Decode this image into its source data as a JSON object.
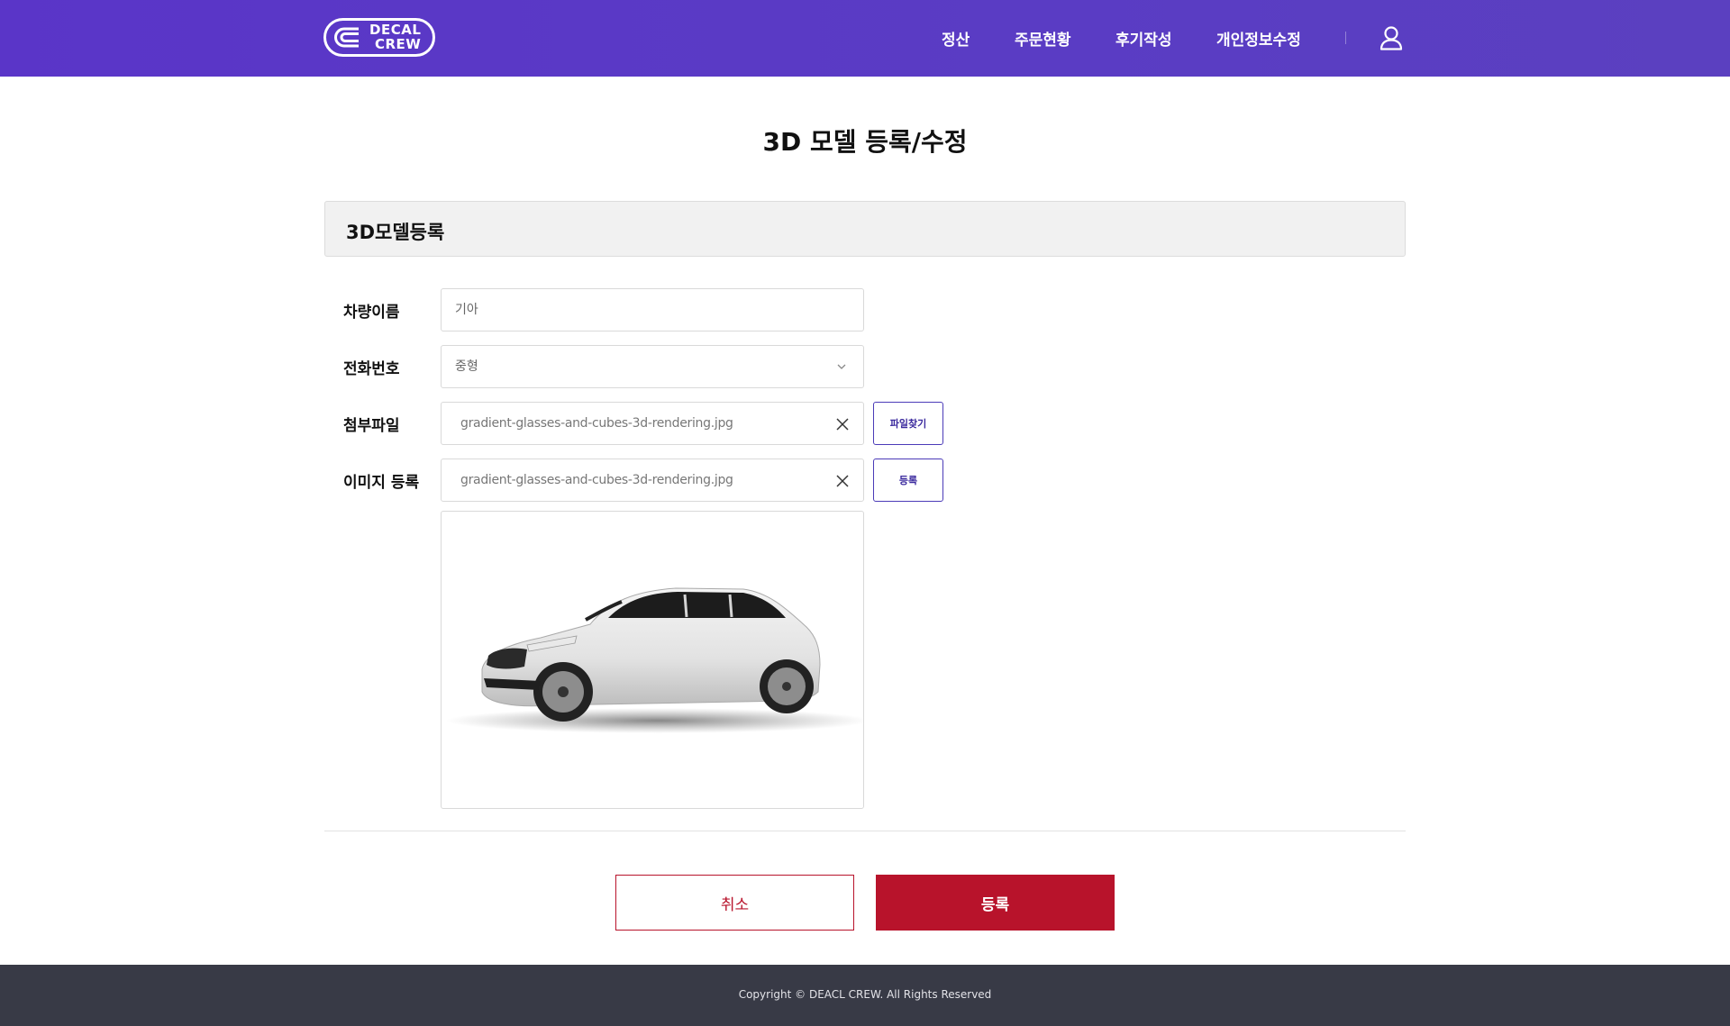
{
  "header": {
    "logo_line1": "DECAL",
    "logo_line2": "CREW",
    "nav": [
      "정산",
      "주문현황",
      "후기작성",
      "개인정보수정"
    ]
  },
  "page": {
    "title": "3D 모델 등록/수정"
  },
  "section": {
    "title": "3D모델등록"
  },
  "form": {
    "vehicle_name_label": "차량이름",
    "vehicle_name_value": "기아",
    "phone_label": "전화번호",
    "phone_value": "중형",
    "attachment_label": "첨부파일",
    "attachment_value": "gradient-glasses-and-cubes-3d-rendering.jpg",
    "find_file_button": "파일찾기",
    "image_label": "이미지 등록",
    "image_value": "gradient-glasses-and-cubes-3d-rendering.jpg",
    "image_register_button": "등록"
  },
  "actions": {
    "cancel": "취소",
    "submit": "등록"
  },
  "footer": {
    "copyright": "Copyright © DEACL CREW. All Rights Reserved"
  },
  "colors": {
    "header_gradient": "#5a35c8",
    "accent_purple": "#4b3bb8",
    "submit_red": "#b8132b",
    "footer_bg": "#383a46"
  }
}
